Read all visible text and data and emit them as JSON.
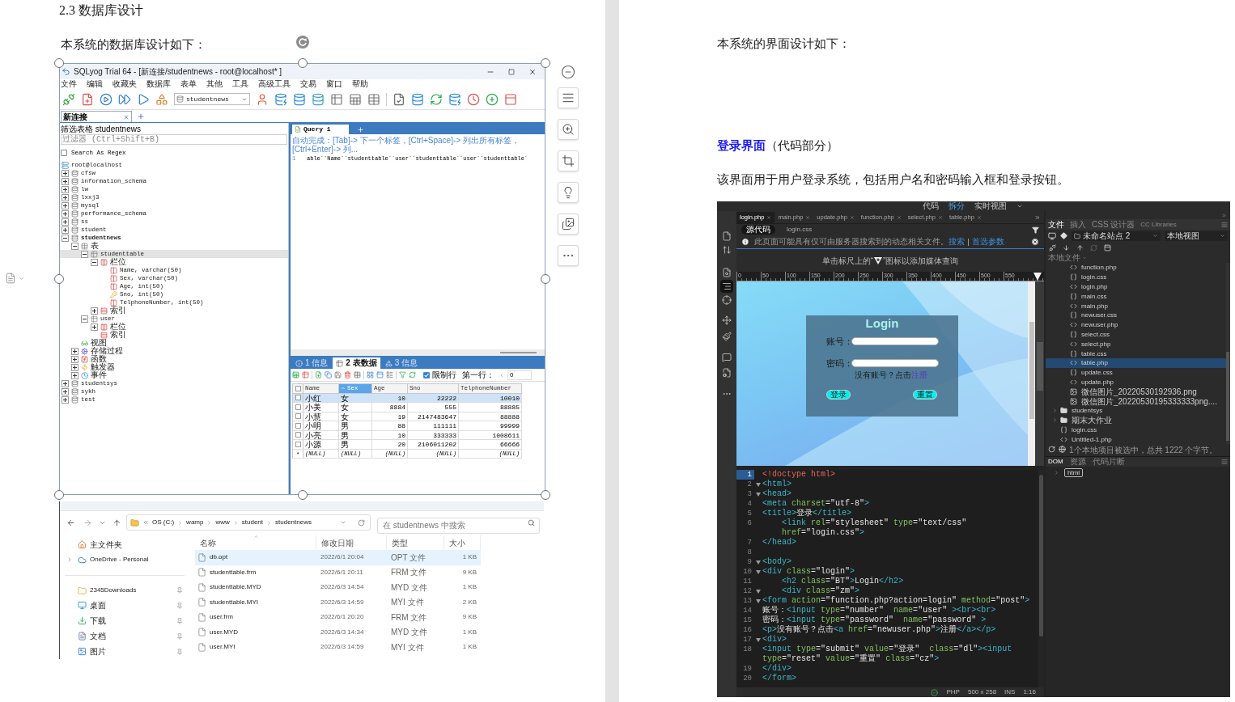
{
  "left_page": {
    "heading": "2.3 数据库设计",
    "intro": "本系统的数据库设计如下：",
    "sqlyog": {
      "title": "SQLyog Trial 64 - [新连接/studentnews - root@localhost* ]",
      "menu": [
        "文件",
        "编辑",
        "收藏夹",
        "数据库",
        "表单",
        "其他",
        "工具",
        "高级工具",
        "交易",
        "窗口",
        "帮助"
      ],
      "database_select": "studentnews",
      "connection_tab": "新连接",
      "filter_label": "筛选表格 studentnews",
      "filter": {
        "placeholder": "过滤器 (Ctrl+Shift+B)"
      },
      "regex": {
        "label": "Search As Regex",
        "checked": false
      },
      "tree": [
        {
          "label": "root@localhost",
          "kind": "server",
          "selected": false,
          "current": false,
          "children": [
            {
              "label": "cfsw",
              "kind": "database",
              "expanded": false,
              "selected": false,
              "current": false
            },
            {
              "label": "information_schema",
              "kind": "database",
              "expanded": false,
              "selected": false,
              "current": false
            },
            {
              "label": "lw",
              "kind": "database",
              "expanded": false,
              "selected": false,
              "current": false
            },
            {
              "label": "lxxj3",
              "kind": "database",
              "expanded": false,
              "selected": false,
              "current": false
            },
            {
              "label": "mysql",
              "kind": "database",
              "expanded": false,
              "selected": false,
              "current": false
            },
            {
              "label": "performance_schema",
              "kind": "database",
              "expanded": false,
              "selected": false,
              "current": false
            },
            {
              "label": "ss",
              "kind": "database",
              "expanded": false,
              "selected": false,
              "current": false
            },
            {
              "label": "student",
              "kind": "database",
              "expanded": false,
              "selected": false,
              "current": false
            },
            {
              "label": "studentnews",
              "kind": "database",
              "expanded": true,
              "selected": false,
              "current": true,
              "children": [
                {
                  "label": "表",
                  "kind": "tables",
                  "expanded": true,
                  "selected": false,
                  "current": false,
                  "children": [
                    {
                      "label": "studenttable",
                      "kind": "table",
                      "expanded": true,
                      "selected": true,
                      "current": false,
                      "children": [
                        {
                          "label": "栏位",
                          "kind": "columns",
                          "expanded": true,
                          "selected": false,
                          "current": false,
                          "children": [
                            {
                              "label": "Name, varchar(50)",
                              "kind": "column",
                              "selected": false,
                              "current": false
                            },
                            {
                              "label": "Sex, varchar(50)",
                              "kind": "column",
                              "selected": false,
                              "current": false
                            },
                            {
                              "label": "Age, int(50)",
                              "kind": "column",
                              "selected": false,
                              "current": false
                            },
                            {
                              "label": "Sno, int(50)",
                              "kind": "key",
                              "selected": false,
                              "current": false
                            },
                            {
                              "label": "TelphoneNumber, int(50)",
                              "kind": "column",
                              "selected": false,
                              "current": false
                            }
                          ]
                        },
                        {
                          "label": "索引",
                          "kind": "index",
                          "expanded": false,
                          "selected": false,
                          "current": false
                        }
                      ]
                    },
                    {
                      "label": "user",
                      "kind": "table",
                      "expanded": true,
                      "selected": false,
                      "current": false,
                      "children": [
                        {
                          "label": "栏位",
                          "kind": "columns",
                          "expanded": false,
                          "selected": false,
                          "current": false
                        },
                        {
                          "label": "索引",
                          "kind": "index",
                          "selected": false,
                          "current": false
                        }
                      ]
                    }
                  ]
                },
                {
                  "label": "视图",
                  "kind": "view",
                  "selected": false,
                  "current": false
                },
                {
                  "label": "存储过程",
                  "kind": "procedure",
                  "expanded": false,
                  "selected": false,
                  "current": false
                },
                {
                  "label": "函数",
                  "kind": "function",
                  "expanded": false,
                  "selected": false,
                  "current": false
                },
                {
                  "label": "触发器",
                  "kind": "trigger",
                  "expanded": false,
                  "selected": false,
                  "current": false
                },
                {
                  "label": "事件",
                  "kind": "event",
                  "expanded": false,
                  "selected": false,
                  "current": false
                }
              ]
            },
            {
              "label": "studentsys",
              "kind": "database",
              "expanded": false,
              "selected": false,
              "current": false
            },
            {
              "label": "sykh",
              "kind": "database",
              "expanded": false,
              "selected": false,
              "current": false
            },
            {
              "label": "test",
              "kind": "database",
              "expanded": false,
              "selected": false,
              "current": false
            }
          ]
        }
      ],
      "query_tab": "Query 1",
      "autocomplete_hint": "自动完成：[Tab]-> 下一个标签，[Ctrl+Space]-> 列出所有标签，[Ctrl+Enter]-> 列...",
      "editor_line": {
        "number": "1",
        "text": "able``Name``studenttable``user``studenttable``user``studenttable`"
      },
      "result_tabs": [
        {
          "label": "1 信息",
          "selected": false
        },
        {
          "label": "2 表数据",
          "selected": true
        },
        {
          "label": "3 信息",
          "selected": false
        }
      ],
      "limit_rows": {
        "label": "限制行",
        "checked": true
      },
      "first_row": {
        "label": "第一行：",
        "value": "0"
      },
      "grid": {
        "header_checked": false,
        "columns": [
          {
            "label": "Name",
            "sorted": false
          },
          {
            "label": "Sex",
            "sorted": true
          },
          {
            "label": "Age",
            "sorted": false
          },
          {
            "label": "Sno",
            "sorted": false
          },
          {
            "label": "TelphoneNumber",
            "sorted": false
          }
        ],
        "rows": [
          {
            "cells": [
              "小红",
              "女",
              "10",
              "22222",
              "10010"
            ],
            "selected": true,
            "checked": false
          },
          {
            "cells": [
              "小美",
              "女",
              "8884",
              "555",
              "88885"
            ],
            "selected": false,
            "checked": false
          },
          {
            "cells": [
              "小慧",
              "女",
              "19",
              "2147483647",
              "88888"
            ],
            "selected": false,
            "checked": false
          },
          {
            "cells": [
              "小明",
              "男",
              "88",
              "111111",
              "99999"
            ],
            "selected": false,
            "checked": false
          },
          {
            "cells": [
              "小亮",
              "男",
              "10",
              "333333",
              "1008611"
            ],
            "selected": false,
            "checked": false
          },
          {
            "cells": [
              "小源",
              "男",
              "20",
              "2106011202",
              "66666"
            ],
            "selected": false,
            "checked": false
          }
        ],
        "new_row": {
          "marker": "*",
          "cells": [
            "(NULL)",
            "(NULL)",
            "(NULL)",
            "(NULL)",
            "(NULL)"
          ]
        }
      }
    },
    "explorer": {
      "path": [
        "OS (C:)",
        "wamp",
        "www",
        "student",
        "studentnews"
      ],
      "search": {
        "placeholder": "在 studentnews 中搜索"
      },
      "nav": [
        {
          "label": "主文件夹",
          "kind": "home",
          "pinned": false
        },
        {
          "label": "OneDrive - Personal",
          "kind": "cloud",
          "pinned": false,
          "expanded": false
        },
        {
          "label": "2345Downloads",
          "kind": "folder",
          "pinned": true
        },
        {
          "label": "桌面",
          "kind": "desktop",
          "pinned": true
        },
        {
          "label": "下载",
          "kind": "download",
          "pinned": true
        },
        {
          "label": "文档",
          "kind": "documents",
          "pinned": true
        },
        {
          "label": "图片",
          "kind": "pictures",
          "pinned": true
        }
      ],
      "columns": [
        "名称",
        "修改日期",
        "类型",
        "大小"
      ],
      "files": [
        {
          "name": "db.opt",
          "modified": "2022/6/1 20:04",
          "type": "OPT 文件",
          "size": "1 KB",
          "selected": true
        },
        {
          "name": "studenttable.frm",
          "modified": "2022/6/1 20:11",
          "type": "FRM 文件",
          "size": "9 KB",
          "selected": false
        },
        {
          "name": "studenttable.MYD",
          "modified": "2022/6/3 14:54",
          "type": "MYD 文件",
          "size": "1 KB",
          "selected": false
        },
        {
          "name": "studenttable.MYI",
          "modified": "2022/6/3 14:59",
          "type": "MYI 文件",
          "size": "2 KB",
          "selected": false
        },
        {
          "name": "user.frm",
          "modified": "2022/6/1 20:20",
          "type": "FRM 文件",
          "size": "9 KB",
          "selected": false
        },
        {
          "name": "user.MYD",
          "modified": "2022/6/3 14:34",
          "type": "MYD 文件",
          "size": "1 KB",
          "selected": false
        },
        {
          "name": "user.MYI",
          "modified": "2022/6/3 14:59",
          "type": "MYI 文件",
          "size": "1 KB",
          "selected": false
        }
      ]
    }
  },
  "right_page": {
    "intro": "本系统的界面设计如下：",
    "section_title": "**登录界面**（代码部分）",
    "description": "该界面用于用户登录系统，包括用户名和密码输入框和登录按钮。",
    "dreamweaver": {
      "view_modes": [
        {
          "label": "代码",
          "selected": false
        },
        {
          "label": "拆分",
          "selected": true
        },
        {
          "label": "实时视图",
          "selected": false
        }
      ],
      "side_tools": [
        {
          "selected": false
        },
        {
          "selected": false
        },
        {
          "selected": false
        },
        {
          "selected": true
        },
        {
          "selected": false
        },
        {
          "selected": false
        },
        {
          "selected": false
        },
        {
          "selected": false
        },
        {
          "selected": false
        },
        {
          "selected": false
        }
      ],
      "doc_tabs": [
        {
          "label": "login.php",
          "selected": true
        },
        {
          "label": "main.php",
          "selected": false
        },
        {
          "label": "update.php",
          "selected": false
        },
        {
          "label": "function.php",
          "selected": false
        },
        {
          "label": "select.php",
          "selected": false
        },
        {
          "label": "table.php",
          "selected": false
        }
      ],
      "related_files": [
        {
          "label": "源代码",
          "selected": true
        },
        {
          "label": "login.css",
          "selected": false
        }
      ],
      "info_bar": {
        "message": "此页面可能具有仅可由服务器搜索到的动态相关文件。",
        "links": [
          "搜索",
          "首选参数"
        ]
      },
      "media_query_hint": {
        "before": "单击标尺上的“",
        "after": "”图标以添加媒体查询"
      },
      "ruler": [
        "0",
        "50",
        "100",
        "150",
        "200",
        "250",
        "300",
        "350",
        "400",
        "450",
        "500",
        "550"
      ],
      "design_view": {
        "title": "Login",
        "field_labels": [
          "账号：",
          "密码："
        ],
        "register_prompt": "没有账号？点击",
        "register_link": "注册",
        "buttons": [
          "登录",
          "重置"
        ]
      },
      "code": [
        {
          "number": "1",
          "text": "<!doctype html>",
          "foldable": false,
          "current": true
        },
        {
          "number": "2",
          "text": "<html>",
          "foldable": true,
          "current": false
        },
        {
          "number": "3",
          "text": "<head>",
          "foldable": true,
          "current": false
        },
        {
          "number": "4",
          "text": "<meta charset=\"utf-8\">",
          "foldable": false,
          "current": false
        },
        {
          "number": "5",
          "text": "<title>登录</title>",
          "foldable": false,
          "current": false
        },
        {
          "number": "6",
          "text": "    <link rel=\"stylesheet\" type=\"text/css\"",
          "continuation": "    href=\"login.css\">",
          "foldable": false,
          "current": false
        },
        {
          "number": "7",
          "text": "</head>",
          "foldable": false,
          "current": false
        },
        {
          "number": "8",
          "foldable": false,
          "current": false
        },
        {
          "number": "9",
          "text": "<body>",
          "foldable": true,
          "current": false
        },
        {
          "number": "10",
          "text": "<div class=\"login\">",
          "foldable": true,
          "current": false
        },
        {
          "number": "11",
          "text": "    <h2 class=\"BT\">Login</h2>",
          "foldable": false,
          "current": false
        },
        {
          "number": "12",
          "text": "    <div class=\"zm\">",
          "foldable": true,
          "current": false
        },
        {
          "number": "13",
          "text": "<form action=\"function.php?action=login\" method=\"post\">",
          "foldable": true,
          "current": false
        },
        {
          "number": "14",
          "text": "账号：<input type=\"number\"  name=\"user\" ><br><br>",
          "foldable": false,
          "current": false
        },
        {
          "number": "15",
          "text": "密码：<input type=\"password\"  name=\"password\" >",
          "foldable": false,
          "current": false
        },
        {
          "number": "16",
          "text": "<p>没有账号？点击<a href=\"newuser.php\">注册</a></p>",
          "foldable": false,
          "current": false
        },
        {
          "number": "17",
          "text": "<div>",
          "foldable": true,
          "current": false
        },
        {
          "number": "18",
          "text": "<input type=\"submit\" value=\"登录\"  class=\"dl\"><input",
          "continuation": "type=\"reset\" value=\"重置\" class=\"cz\">",
          "foldable": false,
          "current": false
        },
        {
          "number": "19",
          "text": "</div>",
          "foldable": false,
          "current": false
        },
        {
          "number": "20",
          "text": "</form>",
          "foldable": false,
          "current": false
        }
      ],
      "status_bar": [
        "PHP",
        "500 x 258",
        "INS",
        "1:16"
      ],
      "panel_tabs": [
        {
          "label": "文件",
          "selected": true
        },
        {
          "label": "插入",
          "selected": false
        },
        {
          "label": "CSS 设计器",
          "selected": false
        },
        {
          "label": "CC Libraries",
          "selected": false
        }
      ],
      "site_select": "未命名站点 2",
      "view_select": "本地视图",
      "local_files_label": "本地文件",
      "open_folder_files": [
        {
          "name": "function.php",
          "kind": "php",
          "selected": false
        },
        {
          "name": "login.css",
          "kind": "css",
          "selected": false
        },
        {
          "name": "login.php",
          "kind": "php",
          "selected": false
        },
        {
          "name": "main.css",
          "kind": "css",
          "selected": false
        },
        {
          "name": "main.php",
          "kind": "php",
          "selected": false
        },
        {
          "name": "newuser.css",
          "kind": "css",
          "selected": false
        },
        {
          "name": "newuser.php",
          "kind": "php",
          "selected": false
        },
        {
          "name": "select.css",
          "kind": "css",
          "selected": false
        },
        {
          "name": "select.php",
          "kind": "php",
          "selected": false
        },
        {
          "name": "table.css",
          "kind": "css",
          "selected": false
        },
        {
          "name": "table.php",
          "kind": "php",
          "selected": true
        },
        {
          "name": "update.css",
          "kind": "css",
          "selected": false
        },
        {
          "name": "update.php",
          "kind": "php",
          "selected": false
        },
        {
          "name": "微信图片_20220530192936.png",
          "kind": "image",
          "selected": false
        },
        {
          "name": "微信图片_20220530195333333png....",
          "kind": "image",
          "selected": false
        }
      ],
      "site_items": [
        {
          "name": "studentsys",
          "kind": "folder",
          "expanded": false,
          "selected": false
        },
        {
          "name": "期末大作业",
          "kind": "folder",
          "expanded": false,
          "selected": false
        },
        {
          "name": "login.css",
          "kind": "css",
          "selected": false
        },
        {
          "name": "Untitled-1.php",
          "kind": "php",
          "selected": false
        }
      ],
      "panel_status": "1个本地项目被选中，总共 1222 个字节。",
      "bottom_tabs": [
        {
          "label": "DOM",
          "selected": true
        },
        {
          "label": "资源",
          "selected": false
        },
        {
          "label": "代码片断",
          "selected": false
        }
      ],
      "dom_tree": [
        {
          "label": "html",
          "expanded": false
        }
      ]
    }
  }
}
